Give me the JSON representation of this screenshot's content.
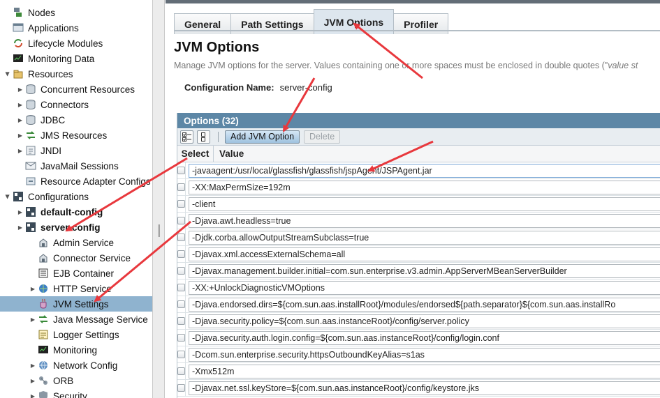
{
  "tree": {
    "items": [
      {
        "label": "Nodes",
        "icon": "nodes-icon",
        "toggle": "",
        "indent": 0,
        "bold": false,
        "selected": false
      },
      {
        "label": "Applications",
        "icon": "applications-icon",
        "toggle": "",
        "indent": 0,
        "bold": false,
        "selected": false
      },
      {
        "label": "Lifecycle Modules",
        "icon": "lifecycle-icon",
        "toggle": "",
        "indent": 0,
        "bold": false,
        "selected": false
      },
      {
        "label": "Monitoring Data",
        "icon": "monitoring-data-icon",
        "toggle": "",
        "indent": 0,
        "bold": false,
        "selected": false
      },
      {
        "label": "Resources",
        "icon": "resources-icon",
        "toggle": "open",
        "indent": 0,
        "bold": false,
        "selected": false
      },
      {
        "label": "Concurrent Resources",
        "icon": "database-icon",
        "toggle": "closed",
        "indent": 1,
        "bold": false,
        "selected": false
      },
      {
        "label": "Connectors",
        "icon": "database-icon",
        "toggle": "closed",
        "indent": 1,
        "bold": false,
        "selected": false
      },
      {
        "label": "JDBC",
        "icon": "database-icon",
        "toggle": "closed",
        "indent": 1,
        "bold": false,
        "selected": false
      },
      {
        "label": "JMS Resources",
        "icon": "jms-icon",
        "toggle": "closed",
        "indent": 1,
        "bold": false,
        "selected": false
      },
      {
        "label": "JNDI",
        "icon": "jndi-icon",
        "toggle": "closed",
        "indent": 1,
        "bold": false,
        "selected": false
      },
      {
        "label": "JavaMail Sessions",
        "icon": "mail-icon",
        "toggle": "",
        "indent": 1,
        "bold": false,
        "selected": false
      },
      {
        "label": "Resource Adapter Configs",
        "icon": "adapter-icon",
        "toggle": "",
        "indent": 1,
        "bold": false,
        "selected": false
      },
      {
        "label": "Configurations",
        "icon": "configurations-icon",
        "toggle": "open",
        "indent": 0,
        "bold": false,
        "selected": false
      },
      {
        "label": "default-config",
        "icon": "config-icon",
        "toggle": "closed",
        "indent": 1,
        "bold": true,
        "selected": false
      },
      {
        "label": "server-config",
        "icon": "config-icon",
        "toggle": "closed",
        "indent": 1,
        "bold": true,
        "selected": false
      },
      {
        "label": "Admin Service",
        "icon": "service-icon",
        "toggle": "",
        "indent": 2,
        "bold": false,
        "selected": false
      },
      {
        "label": "Connector Service",
        "icon": "service-icon",
        "toggle": "",
        "indent": 2,
        "bold": false,
        "selected": false
      },
      {
        "label": "EJB Container",
        "icon": "ejb-icon",
        "toggle": "",
        "indent": 2,
        "bold": false,
        "selected": false
      },
      {
        "label": "HTTP Service",
        "icon": "http-icon",
        "toggle": "closed",
        "indent": 2,
        "bold": false,
        "selected": false
      },
      {
        "label": "JVM Settings",
        "icon": "jvm-icon",
        "toggle": "",
        "indent": 2,
        "bold": false,
        "selected": true
      },
      {
        "label": "Java Message Service",
        "icon": "jms-icon",
        "toggle": "closed",
        "indent": 2,
        "bold": false,
        "selected": false
      },
      {
        "label": "Logger Settings",
        "icon": "logger-icon",
        "toggle": "",
        "indent": 2,
        "bold": false,
        "selected": false
      },
      {
        "label": "Monitoring",
        "icon": "monitoring-icon",
        "toggle": "",
        "indent": 2,
        "bold": false,
        "selected": false
      },
      {
        "label": "Network Config",
        "icon": "network-icon",
        "toggle": "closed",
        "indent": 2,
        "bold": false,
        "selected": false
      },
      {
        "label": "ORB",
        "icon": "orb-icon",
        "toggle": "closed",
        "indent": 2,
        "bold": false,
        "selected": false
      },
      {
        "label": "Security",
        "icon": "security-icon",
        "toggle": "closed",
        "indent": 2,
        "bold": false,
        "selected": false
      }
    ]
  },
  "tabs": [
    {
      "label": "General",
      "active": false
    },
    {
      "label": "Path Settings",
      "active": false
    },
    {
      "label": "JVM Options",
      "active": true
    },
    {
      "label": "Profiler",
      "active": false
    }
  ],
  "page": {
    "title": "JVM Options",
    "help": "Manage JVM options for the server. Values containing one or more spaces must be enclosed in double quotes (\"",
    "help_em": "value st",
    "config_label": "Configuration Name:",
    "config_value": "server-config"
  },
  "table": {
    "title": "Options (32)",
    "add_button": "Add JVM Option",
    "delete_button": "Delete",
    "col_select": "Select",
    "col_value": "Value",
    "rows": [
      "-javaagent:/usr/local/glassfish/glassfish/jspAgent/JSPAgent.jar",
      "-XX:MaxPermSize=192m",
      "-client",
      "-Djava.awt.headless=true",
      "-Djdk.corba.allowOutputStreamSubclass=true",
      "-Djavax.xml.accessExternalSchema=all",
      "-Djavax.management.builder.initial=com.sun.enterprise.v3.admin.AppServerMBeanServerBuilder",
      "-XX:+UnlockDiagnosticVMOptions",
      "-Djava.endorsed.dirs=${com.sun.aas.installRoot}/modules/endorsed${path.separator}${com.sun.aas.installRo",
      "-Djava.security.policy=${com.sun.aas.instanceRoot}/config/server.policy",
      "-Djava.security.auth.login.config=${com.sun.aas.instanceRoot}/config/login.conf",
      "-Dcom.sun.enterprise.security.httpsOutboundKeyAlias=s1as",
      "-Xmx512m",
      "-Djavax.net.ssl.keyStore=${com.sun.aas.instanceRoot}/config/keystore.jks"
    ]
  },
  "colors": {
    "accent": "#5d87a6",
    "selection": "#8fb3cf",
    "annotation_arrow": "#e8383d"
  }
}
